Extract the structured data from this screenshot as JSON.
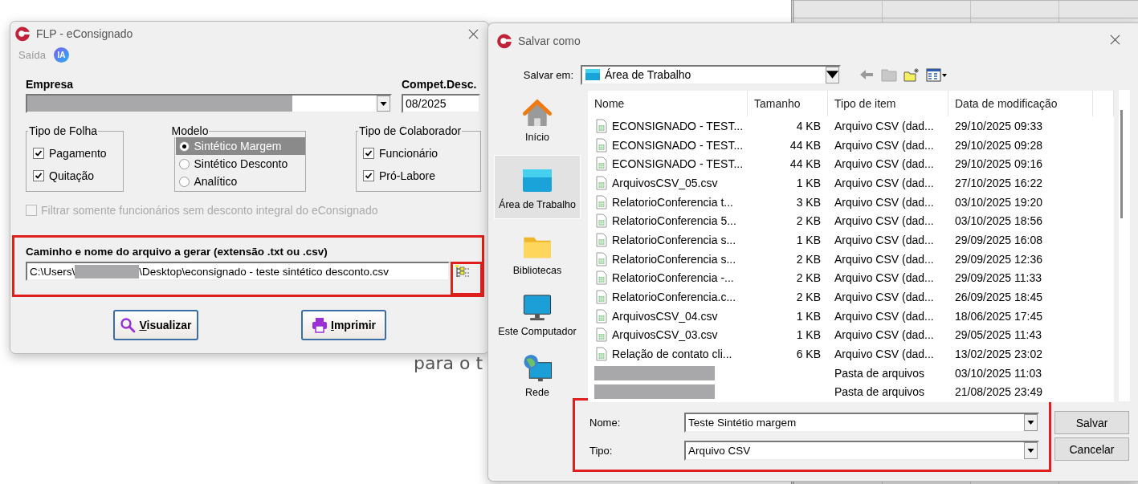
{
  "background": {
    "partial_text": "para o t"
  },
  "main_window": {
    "title": "FLP - eConsignado",
    "menu": [
      {
        "label": "Saída",
        "disabled": true
      }
    ],
    "badge": "IA",
    "empresa": {
      "label": "Empresa"
    },
    "compet": {
      "label": "Compet.Desc.",
      "value": "08/2025"
    },
    "groups": [
      {
        "title": "Tipo de Folha",
        "kind": "checkbox",
        "items": [
          {
            "label": "Pagamento",
            "checked": true
          },
          {
            "label": "Quitação",
            "checked": true
          }
        ]
      },
      {
        "title": "Modelo",
        "kind": "radio",
        "items": [
          {
            "label": "Sintético Margem",
            "selected": true
          },
          {
            "label": "Sintético Desconto",
            "selected": false
          },
          {
            "label": "Analítico",
            "selected": false
          }
        ]
      },
      {
        "title": "Tipo de Colaborador",
        "kind": "checkbox",
        "items": [
          {
            "label": "Funcionário",
            "checked": true
          },
          {
            "label": "Pró-Labore",
            "checked": true
          }
        ]
      }
    ],
    "filter": {
      "label": "Filtrar somente funcionários sem desconto integral do eConsignado",
      "checked": false,
      "disabled": true
    },
    "path": {
      "label": "Caminho e nome do arquivo a gerar (extensão .txt ou .csv)",
      "value_start": "C:\\Users\\",
      "value_end": "\\Desktop\\econsignado - teste sintético desconto.csv"
    },
    "buttons": [
      {
        "label": "Visualizar"
      },
      {
        "label": "Imprimir"
      }
    ]
  },
  "save_dialog": {
    "title": "Salvar como",
    "save_in": {
      "label": "Salvar em:",
      "value": "Área de Trabalho"
    },
    "places": [
      {
        "label": "Início",
        "selected": false
      },
      {
        "label": "Área de Trabalho",
        "selected": true
      },
      {
        "label": "Bibliotecas",
        "selected": false
      },
      {
        "label": "Este Computador",
        "selected": false
      },
      {
        "label": "Rede",
        "selected": false
      }
    ],
    "columns": [
      "Nome",
      "Tamanho",
      "Tipo de item",
      "Data de modificação"
    ],
    "rows": [
      {
        "kind": "file",
        "name": "ECONSIGNADO - TEST...",
        "size": "4 KB",
        "type": "Arquivo CSV (dad...",
        "date": "29/10/2025 09:33"
      },
      {
        "kind": "file",
        "name": "ECONSIGNADO - TEST...",
        "size": "44 KB",
        "type": "Arquivo CSV (dad...",
        "date": "29/10/2025 09:28"
      },
      {
        "kind": "file",
        "name": "ECONSIGNADO - TEST...",
        "size": "44 KB",
        "type": "Arquivo CSV (dad...",
        "date": "29/10/2025 09:16"
      },
      {
        "kind": "file",
        "name": "ArquivosCSV_05.csv",
        "size": "1 KB",
        "type": "Arquivo CSV (dad...",
        "date": "27/10/2025 16:22"
      },
      {
        "kind": "file",
        "name": "RelatorioConferencia t...",
        "size": "3 KB",
        "type": "Arquivo CSV (dad...",
        "date": "03/10/2025 19:20"
      },
      {
        "kind": "file",
        "name": "RelatorioConferencia 5...",
        "size": "2 KB",
        "type": "Arquivo CSV (dad...",
        "date": "03/10/2025 18:56"
      },
      {
        "kind": "file",
        "name": "RelatorioConferencia s...",
        "size": "1 KB",
        "type": "Arquivo CSV (dad...",
        "date": "29/09/2025 16:08"
      },
      {
        "kind": "file",
        "name": "RelatorioConferencia s...",
        "size": "2 KB",
        "type": "Arquivo CSV (dad...",
        "date": "29/09/2025 12:36"
      },
      {
        "kind": "file",
        "name": "RelatorioConferencia -...",
        "size": "2 KB",
        "type": "Arquivo CSV (dad...",
        "date": "29/09/2025 11:33"
      },
      {
        "kind": "file",
        "name": "RelatorioConferencia.c...",
        "size": "2 KB",
        "type": "Arquivo CSV (dad...",
        "date": "26/09/2025 18:45"
      },
      {
        "kind": "file",
        "name": "ArquivosCSV_04.csv",
        "size": "1 KB",
        "type": "Arquivo CSV (dad...",
        "date": "18/06/2025 17:45"
      },
      {
        "kind": "file",
        "name": "ArquivosCSV_03.csv",
        "size": "1 KB",
        "type": "Arquivo CSV (dad...",
        "date": "29/05/2025 11:43"
      },
      {
        "kind": "file",
        "name": "Relação de contato cli...",
        "size": "6 KB",
        "type": "Arquivo CSV (dad...",
        "date": "13/02/2025 23:02"
      },
      {
        "kind": "folder",
        "type": "Pasta de arquivos",
        "date": "03/10/2025 11:03"
      },
      {
        "kind": "folder",
        "type": "Pasta de arquivos",
        "date": "21/08/2025 23:49"
      }
    ],
    "fields": [
      {
        "label": "Nome:",
        "value": "Teste Sintétio margem"
      },
      {
        "label": "Tipo:",
        "value": "Arquivo CSV"
      }
    ],
    "buttons": [
      "Salvar",
      "Cancelar"
    ]
  }
}
